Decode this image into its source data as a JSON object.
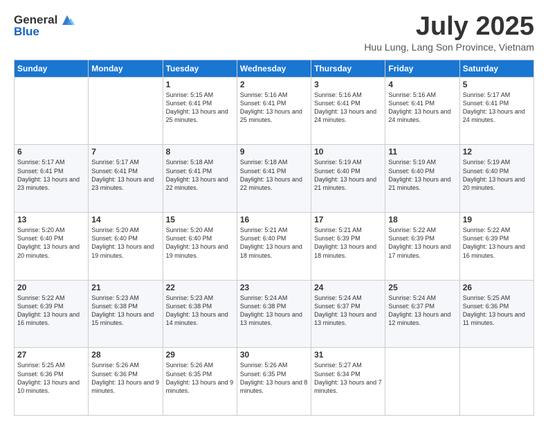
{
  "header": {
    "logo_line1": "General",
    "logo_line2": "Blue",
    "month": "July 2025",
    "location": "Huu Lung, Lang Son Province, Vietnam"
  },
  "weekdays": [
    "Sunday",
    "Monday",
    "Tuesday",
    "Wednesday",
    "Thursday",
    "Friday",
    "Saturday"
  ],
  "weeks": [
    [
      {
        "day": "",
        "sunrise": "",
        "sunset": "",
        "daylight": ""
      },
      {
        "day": "",
        "sunrise": "",
        "sunset": "",
        "daylight": ""
      },
      {
        "day": "1",
        "sunrise": "Sunrise: 5:15 AM",
        "sunset": "Sunset: 6:41 PM",
        "daylight": "Daylight: 13 hours and 25 minutes."
      },
      {
        "day": "2",
        "sunrise": "Sunrise: 5:16 AM",
        "sunset": "Sunset: 6:41 PM",
        "daylight": "Daylight: 13 hours and 25 minutes."
      },
      {
        "day": "3",
        "sunrise": "Sunrise: 5:16 AM",
        "sunset": "Sunset: 6:41 PM",
        "daylight": "Daylight: 13 hours and 24 minutes."
      },
      {
        "day": "4",
        "sunrise": "Sunrise: 5:16 AM",
        "sunset": "Sunset: 6:41 PM",
        "daylight": "Daylight: 13 hours and 24 minutes."
      },
      {
        "day": "5",
        "sunrise": "Sunrise: 5:17 AM",
        "sunset": "Sunset: 6:41 PM",
        "daylight": "Daylight: 13 hours and 24 minutes."
      }
    ],
    [
      {
        "day": "6",
        "sunrise": "Sunrise: 5:17 AM",
        "sunset": "Sunset: 6:41 PM",
        "daylight": "Daylight: 13 hours and 23 minutes."
      },
      {
        "day": "7",
        "sunrise": "Sunrise: 5:17 AM",
        "sunset": "Sunset: 6:41 PM",
        "daylight": "Daylight: 13 hours and 23 minutes."
      },
      {
        "day": "8",
        "sunrise": "Sunrise: 5:18 AM",
        "sunset": "Sunset: 6:41 PM",
        "daylight": "Daylight: 13 hours and 22 minutes."
      },
      {
        "day": "9",
        "sunrise": "Sunrise: 5:18 AM",
        "sunset": "Sunset: 6:41 PM",
        "daylight": "Daylight: 13 hours and 22 minutes."
      },
      {
        "day": "10",
        "sunrise": "Sunrise: 5:19 AM",
        "sunset": "Sunset: 6:40 PM",
        "daylight": "Daylight: 13 hours and 21 minutes."
      },
      {
        "day": "11",
        "sunrise": "Sunrise: 5:19 AM",
        "sunset": "Sunset: 6:40 PM",
        "daylight": "Daylight: 13 hours and 21 minutes."
      },
      {
        "day": "12",
        "sunrise": "Sunrise: 5:19 AM",
        "sunset": "Sunset: 6:40 PM",
        "daylight": "Daylight: 13 hours and 20 minutes."
      }
    ],
    [
      {
        "day": "13",
        "sunrise": "Sunrise: 5:20 AM",
        "sunset": "Sunset: 6:40 PM",
        "daylight": "Daylight: 13 hours and 20 minutes."
      },
      {
        "day": "14",
        "sunrise": "Sunrise: 5:20 AM",
        "sunset": "Sunset: 6:40 PM",
        "daylight": "Daylight: 13 hours and 19 minutes."
      },
      {
        "day": "15",
        "sunrise": "Sunrise: 5:20 AM",
        "sunset": "Sunset: 6:40 PM",
        "daylight": "Daylight: 13 hours and 19 minutes."
      },
      {
        "day": "16",
        "sunrise": "Sunrise: 5:21 AM",
        "sunset": "Sunset: 6:40 PM",
        "daylight": "Daylight: 13 hours and 18 minutes."
      },
      {
        "day": "17",
        "sunrise": "Sunrise: 5:21 AM",
        "sunset": "Sunset: 6:39 PM",
        "daylight": "Daylight: 13 hours and 18 minutes."
      },
      {
        "day": "18",
        "sunrise": "Sunrise: 5:22 AM",
        "sunset": "Sunset: 6:39 PM",
        "daylight": "Daylight: 13 hours and 17 minutes."
      },
      {
        "day": "19",
        "sunrise": "Sunrise: 5:22 AM",
        "sunset": "Sunset: 6:39 PM",
        "daylight": "Daylight: 13 hours and 16 minutes."
      }
    ],
    [
      {
        "day": "20",
        "sunrise": "Sunrise: 5:22 AM",
        "sunset": "Sunset: 6:39 PM",
        "daylight": "Daylight: 13 hours and 16 minutes."
      },
      {
        "day": "21",
        "sunrise": "Sunrise: 5:23 AM",
        "sunset": "Sunset: 6:38 PM",
        "daylight": "Daylight: 13 hours and 15 minutes."
      },
      {
        "day": "22",
        "sunrise": "Sunrise: 5:23 AM",
        "sunset": "Sunset: 6:38 PM",
        "daylight": "Daylight: 13 hours and 14 minutes."
      },
      {
        "day": "23",
        "sunrise": "Sunrise: 5:24 AM",
        "sunset": "Sunset: 6:38 PM",
        "daylight": "Daylight: 13 hours and 13 minutes."
      },
      {
        "day": "24",
        "sunrise": "Sunrise: 5:24 AM",
        "sunset": "Sunset: 6:37 PM",
        "daylight": "Daylight: 13 hours and 13 minutes."
      },
      {
        "day": "25",
        "sunrise": "Sunrise: 5:24 AM",
        "sunset": "Sunset: 6:37 PM",
        "daylight": "Daylight: 13 hours and 12 minutes."
      },
      {
        "day": "26",
        "sunrise": "Sunrise: 5:25 AM",
        "sunset": "Sunset: 6:36 PM",
        "daylight": "Daylight: 13 hours and 11 minutes."
      }
    ],
    [
      {
        "day": "27",
        "sunrise": "Sunrise: 5:25 AM",
        "sunset": "Sunset: 6:36 PM",
        "daylight": "Daylight: 13 hours and 10 minutes."
      },
      {
        "day": "28",
        "sunrise": "Sunrise: 5:26 AM",
        "sunset": "Sunset: 6:36 PM",
        "daylight": "Daylight: 13 hours and 9 minutes."
      },
      {
        "day": "29",
        "sunrise": "Sunrise: 5:26 AM",
        "sunset": "Sunset: 6:35 PM",
        "daylight": "Daylight: 13 hours and 9 minutes."
      },
      {
        "day": "30",
        "sunrise": "Sunrise: 5:26 AM",
        "sunset": "Sunset: 6:35 PM",
        "daylight": "Daylight: 13 hours and 8 minutes."
      },
      {
        "day": "31",
        "sunrise": "Sunrise: 5:27 AM",
        "sunset": "Sunset: 6:34 PM",
        "daylight": "Daylight: 13 hours and 7 minutes."
      },
      {
        "day": "",
        "sunrise": "",
        "sunset": "",
        "daylight": ""
      },
      {
        "day": "",
        "sunrise": "",
        "sunset": "",
        "daylight": ""
      }
    ]
  ]
}
